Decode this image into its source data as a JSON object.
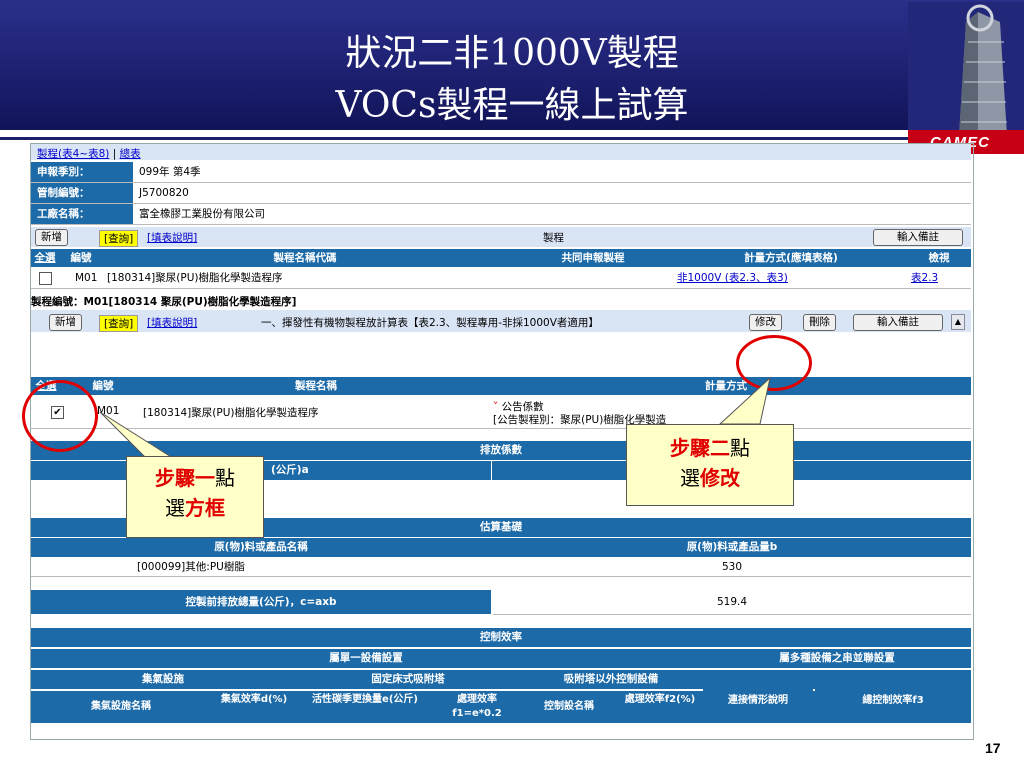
{
  "slide": {
    "title_line1": "狀況二非1000V製程",
    "title_line2": "VOCs製程一線上試算",
    "logo_text": "CAMEC",
    "page_number": "17"
  },
  "tabbar": {
    "tab1": "製程(表4~表8)",
    "sep": "|",
    "tab2": "總表"
  },
  "info": [
    {
      "key": "申報季別：",
      "value": "099年 第4季"
    },
    {
      "key": "管制編號：",
      "value": "J5700820"
    },
    {
      "key": "工廠名稱：",
      "value": "富全橡膠工業股份有限公司"
    }
  ],
  "toolbar1": {
    "add": "新增",
    "query": "查詢",
    "explain": "填表說明",
    "title": "製程",
    "note": "輸入備註"
  },
  "table1": {
    "headers": [
      "全選",
      "編號",
      "製程名稱代碼",
      "共同申報製程",
      "計量方式(應填表格)",
      "檢視"
    ],
    "row": {
      "id": "M01",
      "name": "[180314]聚尿(PU)樹脂化學製造程序",
      "shared": "",
      "method": "非1000V (表2.3、表3)",
      "view": "表2.3"
    }
  },
  "process": {
    "title": "製程編號：M01[180314 聚尿(PU)樹脂化學製造程序]",
    "add": "新增",
    "query": "查詢",
    "explain": "填表說明",
    "desc": "一、揮發性有機物製程放計算表【表2.3、製程專用-非採1000V者適用】",
    "edit": "修改",
    "delete": "刪除",
    "note": "輸入備註"
  },
  "table2": {
    "headers": [
      "全選",
      "編號",
      "製程名稱",
      "計量方式"
    ],
    "row": {
      "id": "M01",
      "name": "[180314]聚尿(PU)樹脂化學製造程序",
      "method_line1": "公告係數",
      "method_line2": "[公告製程別：聚尿(PU)樹脂化學製造"
    }
  },
  "emission": {
    "title": "排放係數",
    "sub": "(公斤)a"
  },
  "estimate": {
    "title": "估算基礎",
    "col1": "原(物)料或產品名稱",
    "col2": "原(物)料或產品量b",
    "row_name": "[000099]其他:PU樹脂",
    "row_value": "530"
  },
  "total": {
    "label": "控製前排放總量(公斤)，c=axb",
    "value": "519.4"
  },
  "control": {
    "title": "控制效率",
    "single": "屬單一設備設置",
    "multi": "屬多種設備之串並聯設置",
    "collect": "集氣設施",
    "fixed": "固定床式吸附塔",
    "other": "吸附塔以外控制設備",
    "c1": "集氣設施名稱",
    "c2": "集氣效率d(%)",
    "c3": "活性碳季更換量e(公斤)",
    "c4": "處理效率f1=e*0.2",
    "c5": "控制設名稱",
    "c6": "處理效率f2(%)",
    "c7": "連接情形說明",
    "c8": "總控制效率f3"
  },
  "callout1": {
    "line1_red": "步驟一",
    "line1_black": "點",
    "line2_black": "選",
    "line2_red": "方框"
  },
  "callout2": {
    "line1_red": "步驟二",
    "line1_black": "點",
    "line2_black": "選",
    "line2_red": "修改"
  },
  "colors": {
    "header_blue": "#1d6aa8",
    "slide_navy": "#1c1f6e",
    "callout_bg": "#ffffc8",
    "highlight_red": "#e00000"
  }
}
